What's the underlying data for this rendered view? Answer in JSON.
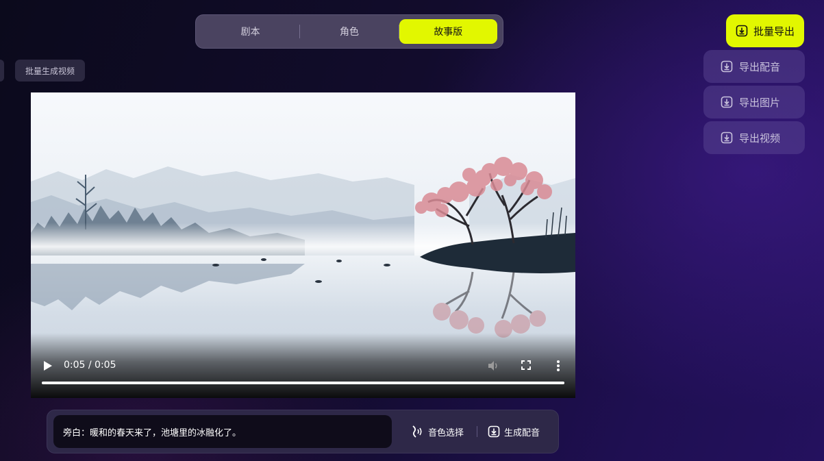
{
  "tabs": [
    {
      "label": "剧本",
      "active": false
    },
    {
      "label": "角色",
      "active": false
    },
    {
      "label": "故事版",
      "active": true
    }
  ],
  "toolbar": {
    "batch_video_label": "批量生成视频"
  },
  "video": {
    "time_display": "0:05 / 0:05",
    "progress": 1.0
  },
  "narration": {
    "text": "旁白：暖和的春天来了，池塘里的冰融化了。",
    "voice_select_label": "音色选择",
    "generate_voice_label": "生成配音"
  },
  "export": {
    "batch_export_label": "批量导出",
    "items": [
      {
        "label": "导出配音"
      },
      {
        "label": "导出图片"
      },
      {
        "label": "导出视频"
      }
    ]
  },
  "colors": {
    "accent": "#e2f700",
    "panel": "#2e2848",
    "background": "#120c2c"
  },
  "icons": {
    "export": "download-icon",
    "voice": "sound-wave-icon",
    "play": "play-icon",
    "volume": "volume-icon",
    "fullscreen": "fullscreen-icon",
    "more": "more-vertical-icon"
  }
}
